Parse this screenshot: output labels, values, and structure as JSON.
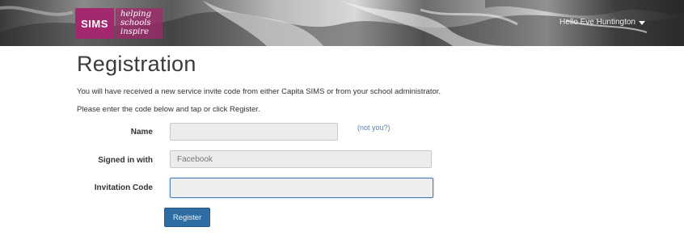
{
  "header": {
    "logo_text": "SIMS",
    "tagline_line1": "helping",
    "tagline_line2": "schools",
    "tagline_line3": "inspire",
    "greeting": "Hello Eve Huntington",
    "brand_color": "#a3286e"
  },
  "main": {
    "title": "Registration",
    "intro": "You will have received a new service invite code from either Capita SIMS or from your school administrator.",
    "instruction": "Please enter the code below and tap or click Register."
  },
  "form": {
    "name_label": "Name",
    "name_value": "",
    "not_you_link": "(not you?)",
    "signed_in_label": "Signed in with",
    "signed_in_value": "Facebook",
    "invitation_label": "Invitation Code",
    "invitation_value": "",
    "register_label": "Register"
  },
  "icons": {
    "user_menu": "caret-down-icon"
  },
  "colors": {
    "button": "#2e6da4",
    "link": "#5a7fb0",
    "focus_border": "#4a7fb8"
  }
}
